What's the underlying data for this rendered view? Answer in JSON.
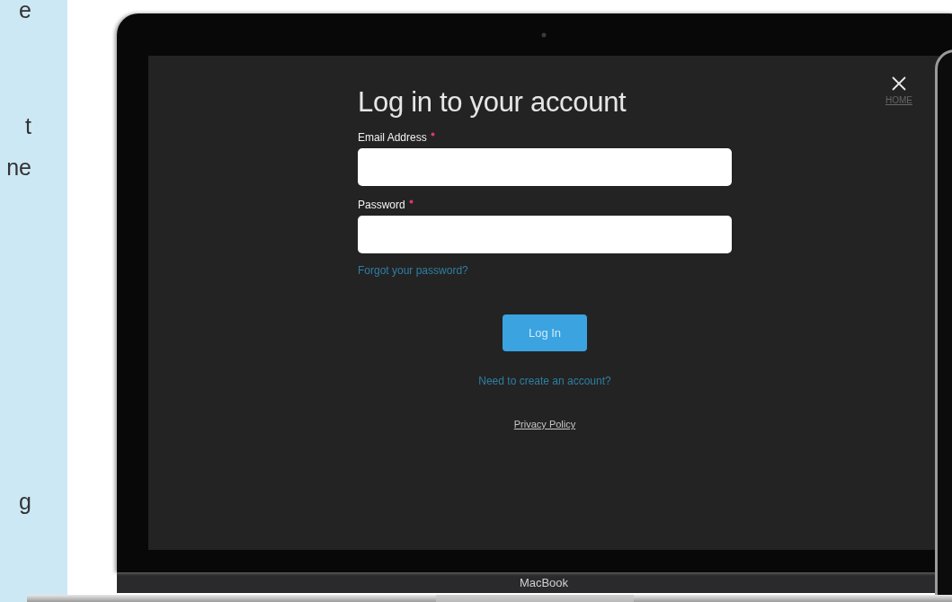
{
  "sidebar": {
    "fragments": [
      "e",
      "t",
      "ne",
      "g"
    ]
  },
  "login": {
    "title": "Log in to your account",
    "fields": [
      {
        "label": "Email Address",
        "required": true
      },
      {
        "label": "Password",
        "required": true
      }
    ],
    "forgot_link": "Forgot your password?",
    "button": "Log In",
    "signup_link": "Need to create an account?",
    "privacy_link": "Privacy Policy",
    "home_link": "HOME"
  },
  "device": {
    "label": "MacBook"
  }
}
